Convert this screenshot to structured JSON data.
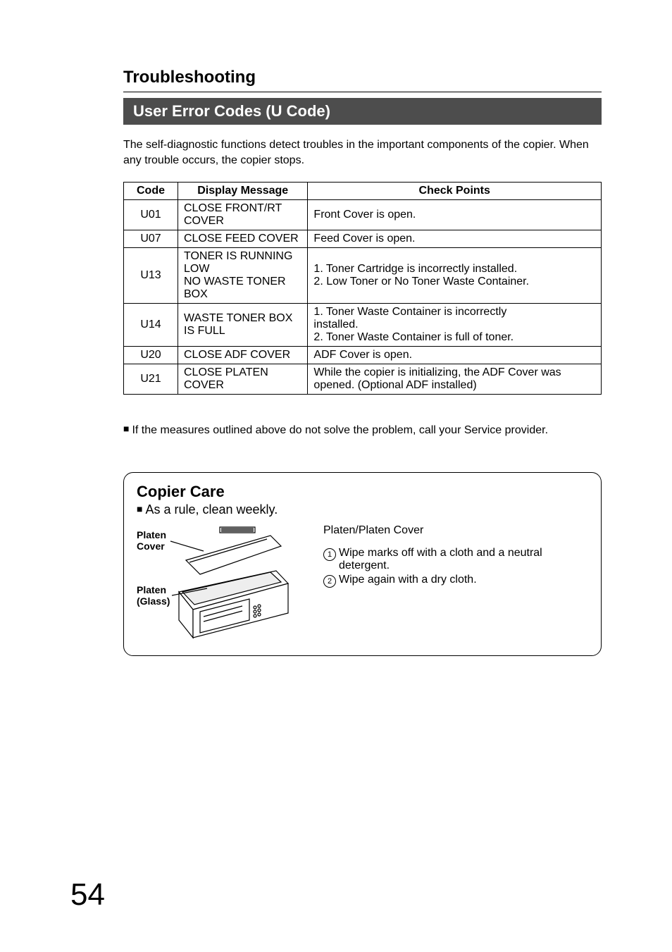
{
  "section_title": "Troubleshooting",
  "subsection_title": "User Error Codes (U Code)",
  "intro_text": "The self-diagnostic functions detect troubles in the important components of the copier. When any trouble occurs, the copier stops.",
  "table": {
    "headers": {
      "code": "Code",
      "message": "Display Message",
      "check": "Check Points"
    },
    "rows": [
      {
        "code": "U01",
        "message": "CLOSE FRONT/RT COVER",
        "check": "Front Cover is open."
      },
      {
        "code": "U07",
        "message": "CLOSE FEED COVER",
        "check": "Feed Cover is open."
      },
      {
        "code": "U13",
        "message": "TONER IS RUNNING LOW\nNO WASTE TONER BOX",
        "check": "1. Toner Cartridge is incorrectly installed.\n2. Low Toner or No Toner Waste Container."
      },
      {
        "code": "U14",
        "message": "WASTE TONER BOX IS FULL",
        "check": "1. Toner Waste Container is incorrectly\n    installed.\n2. Toner Waste Container is full of toner."
      },
      {
        "code": "U20",
        "message": "CLOSE ADF COVER",
        "check": "ADF Cover is open."
      },
      {
        "code": "U21",
        "message": "CLOSE PLATEN COVER",
        "check": "While the copier is initializing, the ADF Cover was opened. (Optional ADF installed)"
      }
    ]
  },
  "note": "If the measures outlined above do not solve the problem, call your Service provider.",
  "care": {
    "title": "Copier Care",
    "subtitle": "As a rule, clean weekly.",
    "figure_labels": {
      "platen_cover": "Platen\nCover",
      "platen_glass": "Platen\n(Glass)"
    },
    "right_heading": "Platen/Platen Cover",
    "steps": [
      "Wipe marks off with a cloth and a neutral detergent.",
      "Wipe again with a dry cloth."
    ]
  },
  "page_number": "54"
}
